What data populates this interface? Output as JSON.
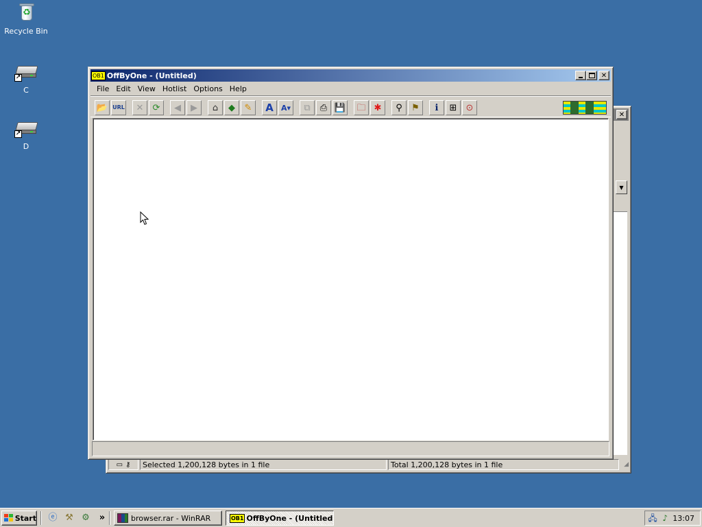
{
  "desktop": {
    "icons": [
      {
        "label": "Recycle Bin"
      },
      {
        "label": "C"
      },
      {
        "label": "D"
      }
    ]
  },
  "winrar": {
    "status_left": "Selected 1,200,128 bytes in 1 file",
    "status_right": "Total 1,200,128 bytes in 1 file"
  },
  "offbyone": {
    "badge": "OB1",
    "title": "OffByOne - (Untitled)",
    "menu": [
      {
        "label": "File"
      },
      {
        "label": "Edit"
      },
      {
        "label": "View"
      },
      {
        "label": "Hotlist"
      },
      {
        "label": "Options"
      },
      {
        "label": "Help"
      }
    ],
    "toolbar": {
      "url_label": "URL"
    }
  },
  "taskbar": {
    "start_label": "Start",
    "chevron": "»",
    "tasks": [
      {
        "label": "browser.rar - WinRAR"
      },
      {
        "label": "OffByOne - (Untitled)"
      }
    ],
    "task_badge": "OB1",
    "clock": "13:07"
  },
  "colors": {
    "desktop": "#3a6ea5",
    "title_active_start": "#0a246a",
    "title_active_end": "#a6caf0",
    "title_inactive": "#808080",
    "chrome": "#d4d0c8"
  }
}
